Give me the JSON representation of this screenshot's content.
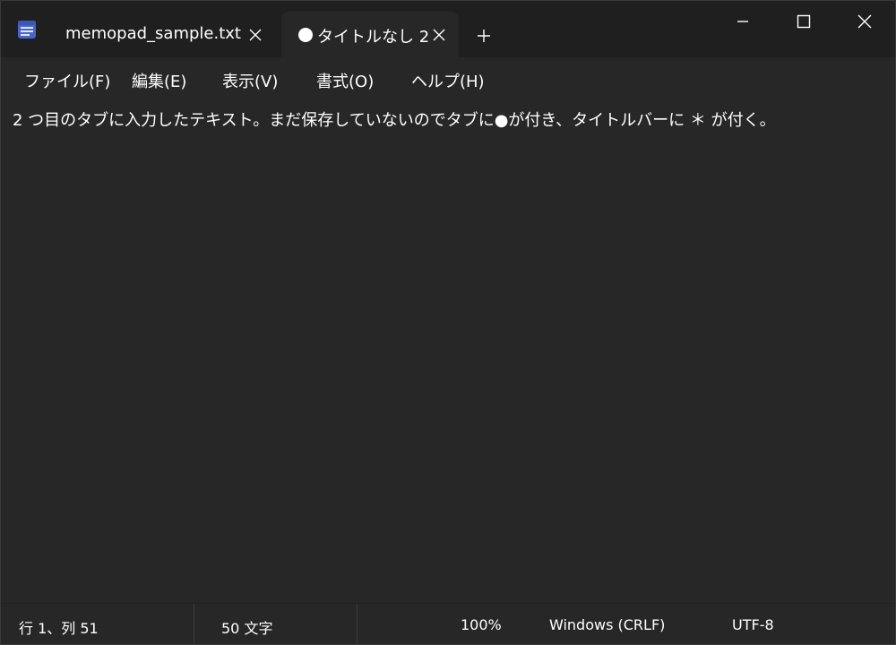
{
  "tabs": [
    {
      "label": "memopad_sample.txt",
      "active": false,
      "unsaved": false
    },
    {
      "label": "タイトルなし 2",
      "active": true,
      "unsaved": true
    }
  ],
  "menu": {
    "file": "ファイル(F)",
    "edit": "編集(E)",
    "view": "表示(V)",
    "format": "書式(O)",
    "help": "ヘルプ(H)"
  },
  "editor": {
    "content": "2 つ目のタブに入力したテキスト。まだ保存していないのでタブに●が付き、タイトルバーに ＊ が付く。"
  },
  "status": {
    "position": "行 1、列 51",
    "char_count": "50 文字",
    "zoom": "100%",
    "line_ending": "Windows (CRLF)",
    "encoding": "UTF-8"
  },
  "colors": {
    "background": "#272727",
    "titlebar": "#1f1f1f",
    "text": "#ffffff"
  },
  "icons": {
    "app": "notepad-icon",
    "tab_close": "close-icon",
    "new_tab": "plus-icon",
    "minimize": "minimize-icon",
    "maximize": "maximize-icon",
    "close": "close-icon"
  }
}
